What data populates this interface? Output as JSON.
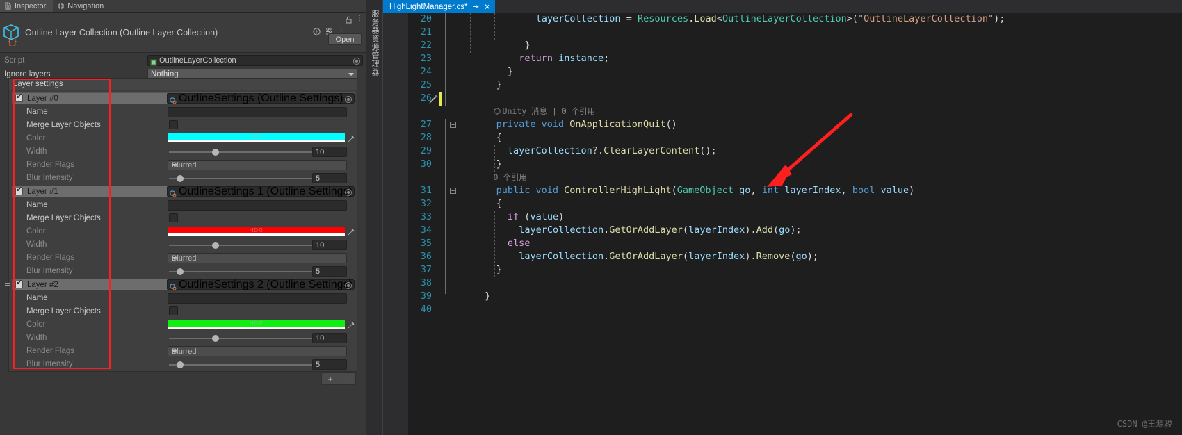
{
  "inspector": {
    "tabs": [
      {
        "label": "Inspector",
        "icon": "inspector-icon",
        "active": true
      },
      {
        "label": "Navigation",
        "icon": "navigation-icon",
        "active": false
      }
    ],
    "header": {
      "title": "Outline Layer Collection (Outline Layer Collection)",
      "icon": "script-asset-icon",
      "help_icon": "help-icon",
      "preset_icon": "preset-icon",
      "menu_icon": "kebab-menu-icon",
      "lock_icon": "lock-icon",
      "open_button": "Open"
    },
    "script_row": {
      "label": "Script",
      "value": "OutlineLayerCollection"
    },
    "ignore_layers": {
      "label": "Ignore layers",
      "value": "Nothing"
    },
    "layer_settings_title": "Layer settings",
    "field_labels": {
      "name": "Name",
      "merge": "Merge Layer Objects",
      "color": "Color",
      "width": "Width",
      "render_flags": "Render Flags",
      "blur_intensity": "Blur Intensity"
    },
    "hdr_badge": "HDR",
    "layers": [
      {
        "name": "Layer #0",
        "enabled": true,
        "settings_asset": "OutlineSettings (Outline Settings)",
        "name_value": "",
        "merge_checked": false,
        "color": "#00FFFF",
        "width": "10",
        "render_flags": "Blurred",
        "blur_intensity": "5"
      },
      {
        "name": "Layer #1",
        "enabled": true,
        "settings_asset": "OutlineSettings 1 (Outline Settings)",
        "name_value": "",
        "merge_checked": false,
        "color": "#FF0000",
        "width": "10",
        "render_flags": "Blurred",
        "blur_intensity": "5"
      },
      {
        "name": "Layer #2",
        "enabled": true,
        "settings_asset": "OutlineSettings 2 (Outline Settings)",
        "name_value": "",
        "merge_checked": false,
        "color": "#11EE11",
        "width": "10",
        "render_flags": "Blurred",
        "blur_intensity": "5"
      }
    ],
    "list_buttons": {
      "add": "+",
      "remove": "−"
    }
  },
  "side_strip": {
    "vertical_label": "服务器资源管理器"
  },
  "editor": {
    "tab": {
      "title": "HighLightManager.cs*",
      "pin_icon": "pin-icon",
      "close_icon": "close-icon"
    },
    "codelens": {
      "unity_message": "Unity 消息 | 0 个引用",
      "zero_refs": "0 个引用"
    },
    "lines": [
      {
        "num": "20",
        "indent": 11
      },
      {
        "num": "21",
        "indent": 0
      },
      {
        "num": "22",
        "indent": 0
      },
      {
        "num": "23",
        "indent": 0
      },
      {
        "num": "24",
        "indent": 0
      },
      {
        "num": "25",
        "indent": 0
      },
      {
        "num": "26",
        "indent": 0
      },
      {
        "num": "27",
        "indent": 0
      },
      {
        "num": "28",
        "indent": 0
      },
      {
        "num": "29",
        "indent": 0
      },
      {
        "num": "30",
        "indent": 0
      },
      {
        "num": "31",
        "indent": 0
      },
      {
        "num": "32",
        "indent": 0
      },
      {
        "num": "33",
        "indent": 0
      },
      {
        "num": "34",
        "indent": 0
      },
      {
        "num": "35",
        "indent": 0
      },
      {
        "num": "36",
        "indent": 0
      },
      {
        "num": "37",
        "indent": 0
      },
      {
        "num": "38",
        "indent": 0
      },
      {
        "num": "39",
        "indent": 0
      },
      {
        "num": "40",
        "indent": 0
      }
    ],
    "code": {
      "l20": "layerCollection = Resources.Load<OutlineLayerCollection>(\"OutlineLayerCollection\");",
      "l22": "}",
      "l23": "return instance;",
      "l24": "}",
      "l25": "}",
      "l27": "private void OnApplicationQuit()",
      "l28": "{",
      "l29": "layerCollection?.ClearLayerContent();",
      "l30": "}",
      "l31": "public void ControllerHighLight(GameObject go, int layerIndex, bool value)",
      "l32": "{",
      "l33": "if (value)",
      "l34": "layerCollection.GetOrAddLayer(layerIndex).Add(go);",
      "l35": "else",
      "l36": "layerCollection.GetOrAddLayer(layerIndex).Remove(go);",
      "l37": "}",
      "l39": "}"
    }
  },
  "watermark": "CSDN @王源骏",
  "colors": {
    "accent_blue": "#007acc",
    "annotation_red": "#ff1f1f",
    "keyword": "#569cd6",
    "control": "#d8a0df",
    "type": "#4ec9b0",
    "method": "#dcdcaa",
    "variable": "#9cdcfe",
    "string": "#d69d85"
  }
}
